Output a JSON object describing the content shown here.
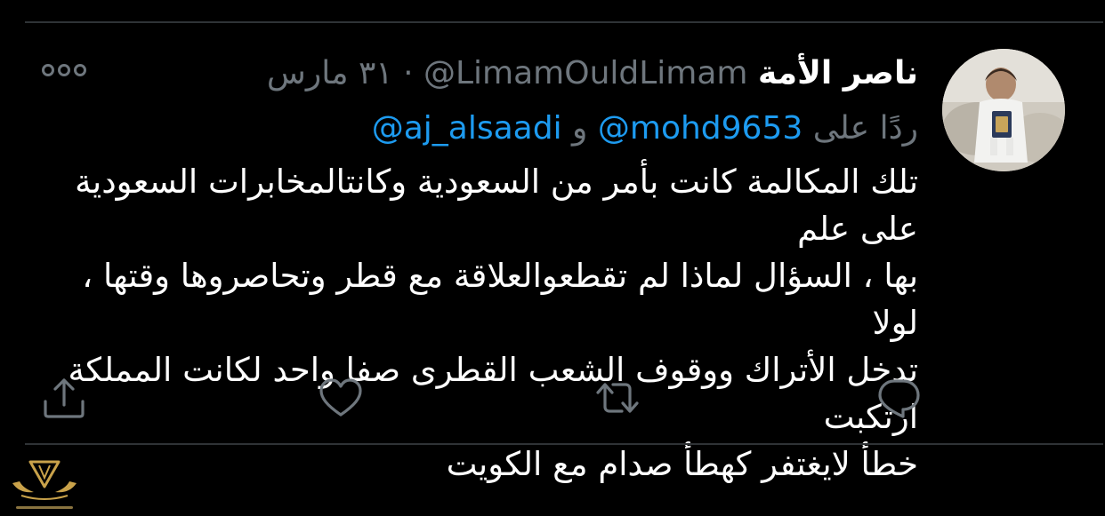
{
  "tweet": {
    "display_name": "ناصر الأمة",
    "handle": "@LimamOuldLimam",
    "separator": "·",
    "date": "٣١ مارس",
    "reply_to": {
      "prefix": "ردًا على",
      "mention_1": "@mohd9653",
      "conjunction": "و",
      "mention_2": "@aj_alsaadi"
    },
    "body_lines": [
      "تلك المكالمة كانت بأمر من السعودية وكانتالمخابرات السعودية على علم",
      "بها ، السؤال لماذا لم تقطعوالعلاقة مع قطر وتحاصروها وقتها ، لولا",
      "تدخل الأتراك ووقوف الشعب القطرى صفا واحد  لكانت المملكة ارتكبت",
      "خطأ لايغتفر كهطأ صدام مع الكويت"
    ]
  },
  "actions": {
    "reply_icon": "speech-bubble-icon",
    "retweet_icon": "retweet-arrows-icon",
    "like_icon": "heart-outline-icon",
    "share_icon": "share-upload-icon",
    "more_icon": "three-dots-icon"
  },
  "colors": {
    "background": "#000000",
    "primary_text": "#ffffff",
    "secondary_text": "#6e767d",
    "link": "#1d9bf0",
    "divider": "#2f3336",
    "icon": "#6e767d"
  }
}
